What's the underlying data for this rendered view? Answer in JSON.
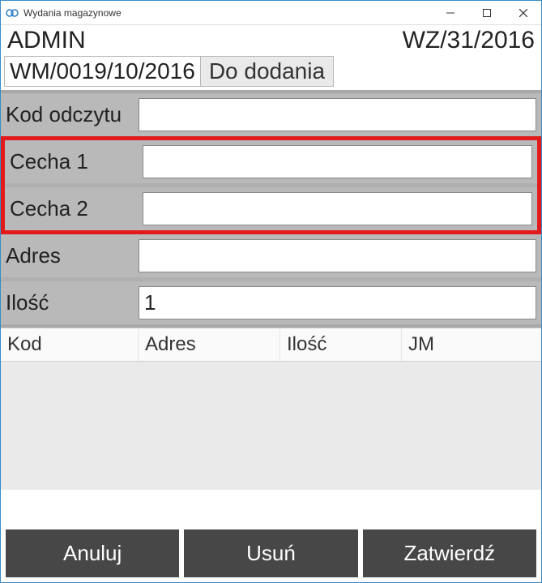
{
  "window": {
    "title": "Wydania magazynowe"
  },
  "header": {
    "user": "ADMIN",
    "ref": "WZ/31/2016"
  },
  "doc": {
    "number_label": "WM/0019/10/2016",
    "tab_label": "Do dodania"
  },
  "fields": {
    "kod_odczytu": {
      "label": "Kod odczytu",
      "value": ""
    },
    "cecha1": {
      "label": "Cecha 1",
      "value": ""
    },
    "cecha2": {
      "label": "Cecha 2",
      "value": ""
    },
    "adres": {
      "label": "Adres",
      "value": ""
    },
    "ilosc": {
      "label": "Ilość",
      "value": "1"
    }
  },
  "table": {
    "columns": [
      "Kod",
      "Adres",
      "Ilość",
      "JM"
    ],
    "rows": []
  },
  "buttons": {
    "cancel": "Anuluj",
    "delete": "Usuń",
    "confirm": "Zatwierdź"
  }
}
